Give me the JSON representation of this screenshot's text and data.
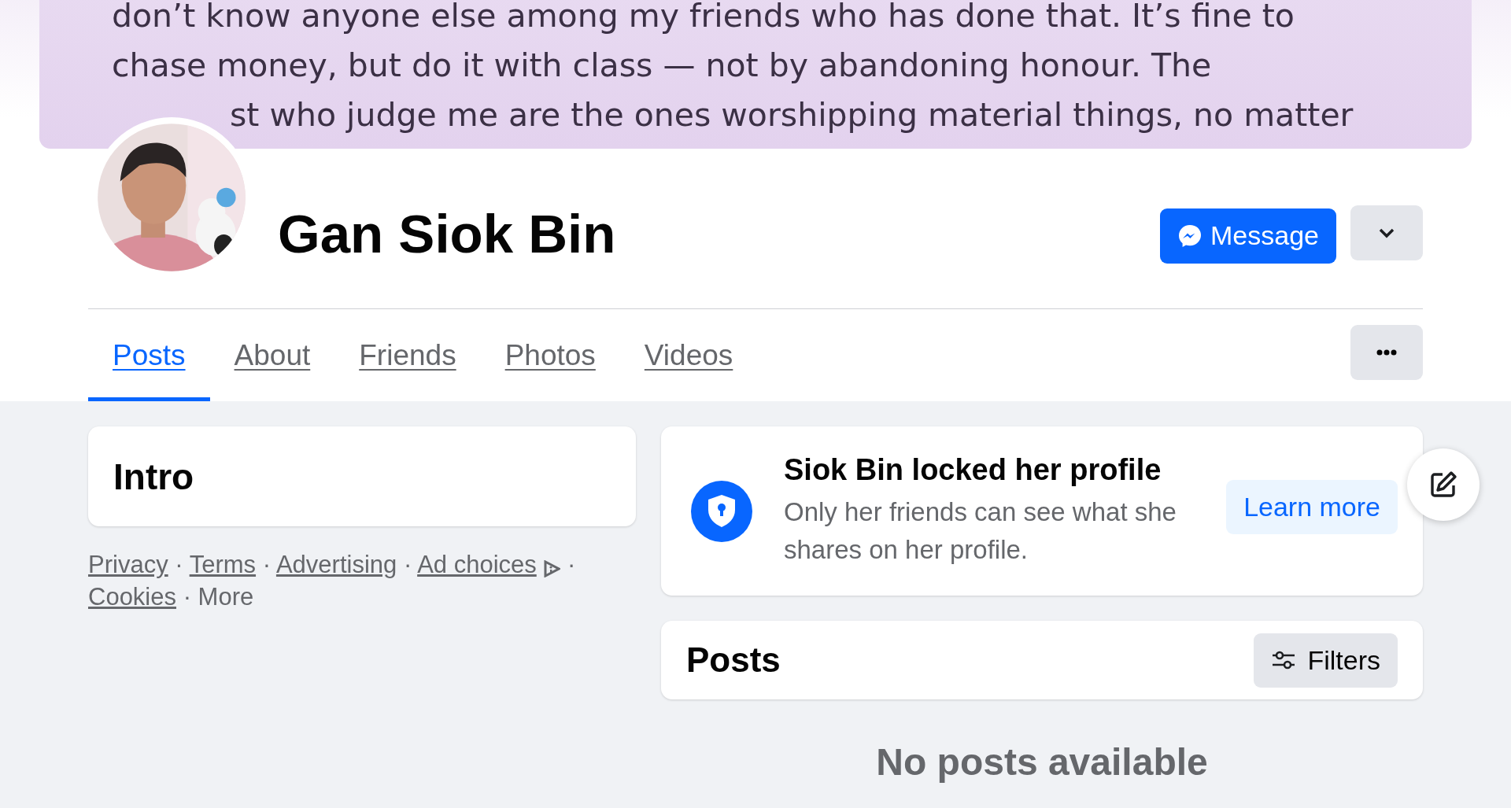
{
  "banner": {
    "lines": [
      "don’t know anyone else among my friends who has done that. It’s fine to",
      "chase money, but do it with class — not by abandoning honour. The",
      "st who judge me are the ones worshipping material things, no matter"
    ]
  },
  "profile": {
    "name": "Gan Siok Bin",
    "message_button": "Message"
  },
  "tabs": [
    {
      "label": "Posts",
      "selected": true
    },
    {
      "label": "About",
      "selected": false
    },
    {
      "label": "Friends",
      "selected": false
    },
    {
      "label": "Photos",
      "selected": false
    },
    {
      "label": "Videos",
      "selected": false
    }
  ],
  "intro": {
    "title": "Intro"
  },
  "footer_separator": "·",
  "footer_links": [
    {
      "label": "Privacy",
      "kind": "link"
    },
    {
      "label": "Terms",
      "kind": "link"
    },
    {
      "label": "Advertising",
      "kind": "link"
    },
    {
      "label": "Ad choices",
      "kind": "adchoices"
    },
    {
      "label": "Cookies",
      "kind": "link"
    },
    {
      "label": "More",
      "kind": "plain"
    }
  ],
  "locked_notice": {
    "title": "Siok Bin locked her profile",
    "text": "Only her friends can see what she shares on her profile.",
    "button": "Learn more"
  },
  "posts": {
    "title": "Posts",
    "filters_button": "Filters",
    "empty_text": "No posts available"
  }
}
